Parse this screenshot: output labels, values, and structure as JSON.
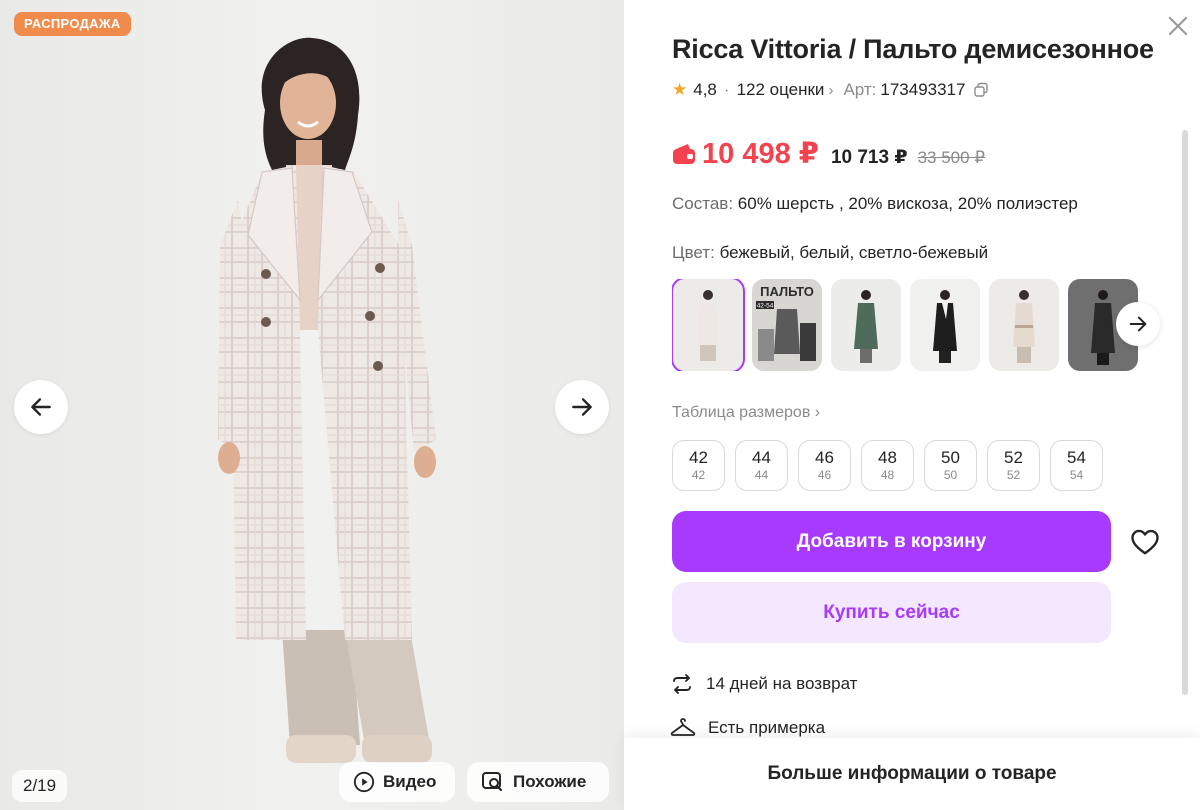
{
  "gallery": {
    "badge": "РАСПРОДАЖА",
    "counter": "2/19",
    "video_label": "Видео",
    "similar_label": "Похожие"
  },
  "product": {
    "title": "Ricca Vittoria / Пальто демисезонное",
    "rating": "4,8",
    "reviews": "122 оценки",
    "article_label": "Арт:",
    "article": "173493317",
    "price": "10 498 ₽",
    "wallet_price": "10 713 ₽",
    "old_price": "33 500 ₽",
    "composition_label": "Состав:",
    "composition": "60% шерсть , 20% вискоза, 20% полиэстер",
    "color_label": "Цвет:",
    "color": "бежевый, белый, светло-бежевый",
    "thumb_text": "ПАЛЬТО",
    "thumb_sizes": "42-54",
    "size_table": "Таблица размеров",
    "sizes": [
      {
        "main": "42",
        "ru": "42"
      },
      {
        "main": "44",
        "ru": "44"
      },
      {
        "main": "46",
        "ru": "46"
      },
      {
        "main": "48",
        "ru": "48"
      },
      {
        "main": "50",
        "ru": "50"
      },
      {
        "main": "52",
        "ru": "52"
      },
      {
        "main": "54",
        "ru": "54"
      }
    ],
    "add_to_cart": "Добавить в корзину",
    "buy_now": "Купить сейчас",
    "features": {
      "return": "14 дней на возврат",
      "fitting": "Есть примерка"
    },
    "more_info": "Больше информации о товаре"
  },
  "colors": {
    "accent": "#a73afd",
    "accent_light": "#f3e8fd",
    "price_red": "#f2434f",
    "badge_orange": "#f08b4b",
    "rating_star": "#f5a623"
  }
}
